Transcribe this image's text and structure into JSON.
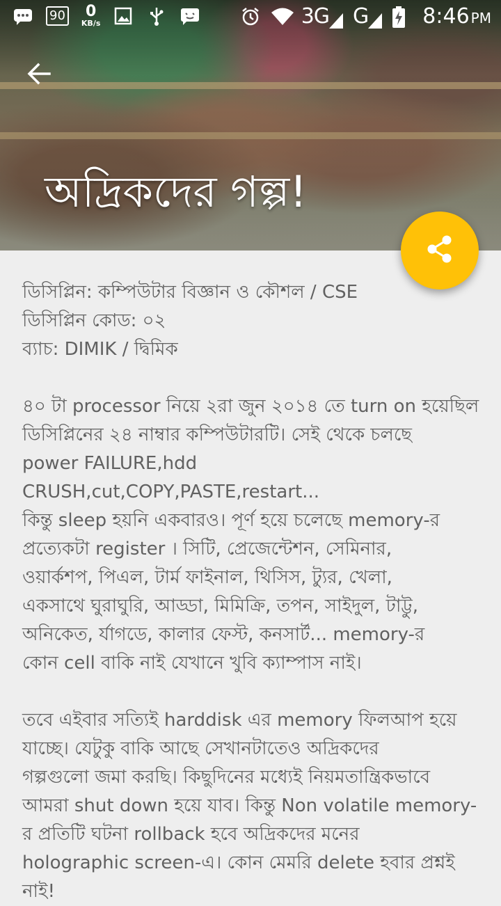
{
  "status_bar": {
    "data_saver_label": "90",
    "net_speed_value": "0",
    "net_speed_unit": "KB/s",
    "network_3g": "3G",
    "network_g": "G",
    "time": "8:46",
    "ampm": "PM"
  },
  "header": {
    "title": "অদ্রিকদের গল্প!"
  },
  "icons": {
    "back": "arrow-back-icon",
    "share": "share-icon"
  },
  "colors": {
    "fab": "#ffc107",
    "text": "#616161",
    "background": "#eeeeee"
  },
  "article": {
    "meta": [
      "ডিসিপ্লিন: কম্পিউটার বিজ্ঞান ও কৌশল / CSE",
      "ডিসিপ্লিন কোড: ০২",
      "ব্যাচ: DIMIK / দ্বিমিক"
    ],
    "paragraph1": [
      "৪০ টা processor নিয়ে ২রা জুন ২০১৪ তে turn on হয়েছিল",
      "ডিসিপ্লিনের ২৪ নাম্বার কম্পিউটারটি। সেই থেকে চলছে",
      "power FAILURE,hdd CRUSH,cut,COPY,PASTE,restart...",
      "কিন্তু sleep হয়নি একবারও। পূর্ণ হয়ে চলেছে memory-র",
      "প্রত্যেকটা register । সিটি, প্রেজেন্টেশন, সেমিনার,",
      "ওয়ার্কশপ, পিএল, টার্ম ফাইনাল, থিসিস, ট্যুর, খেলা,",
      "একসাথে ঘুরাঘুরি, আড্ডা, মিমিক্রি, তপন, সাইদুল, টাট্টু,",
      "অনিকেত, র্যাগডে, কালার ফেস্ট, কনসার্ট... memory-র",
      "কোন cell বাকি নাই যেখানে খুবি ক্যাম্পাস নাই।"
    ],
    "paragraph2": [
      "তবে এইবার সত্যিই harddisk এর memory ফিলআপ হয়ে",
      "যাচ্ছে। যেটুকু বাকি আছে সেখানটাতেও অদ্রিকদের",
      "গল্পগুলো জমা করছি। কিছুদিনের মধ্যেই নিয়মতান্ত্রিকভাবে",
      "আমরা shut down হয়ে যাব। কিন্তু Non volatile memory-",
      "র প্রতিটি ঘটনা rollback হবে অদ্রিকদের মনের",
      "holographic screen-এ। কোন মেমরি delete হবার প্রশ্নই",
      "নাই!"
    ]
  }
}
